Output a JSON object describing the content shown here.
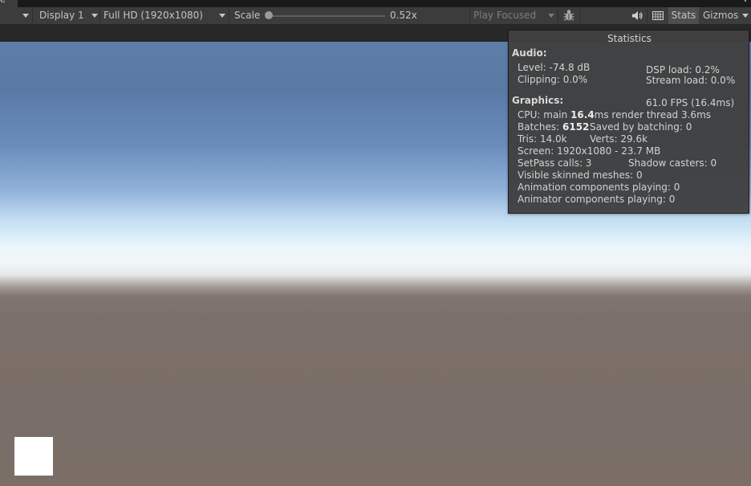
{
  "tab": {
    "label": "e"
  },
  "toolbar": {
    "display": "Display 1",
    "resolution": "Full HD (1920x1080)",
    "scale_label": "Scale",
    "scale_value": "0.52x",
    "scale_fraction": 0.0,
    "play_mode": "Play Focused",
    "stats_label": "Stats",
    "gizmos_label": "Gizmos",
    "icons": [
      "bug-icon",
      "speaker-icon",
      "keyboard-icon"
    ]
  },
  "stats": {
    "title": "Statistics",
    "audio_header": "Audio:",
    "level": "Level: -74.8 dB",
    "dsp_load": "DSP load: 0.2%",
    "clipping": "Clipping: 0.0%",
    "stream_load": "Stream load: 0.0%",
    "graphics_header": "Graphics:",
    "fps": "61.0 FPS (16.4ms)",
    "cpu_prefix": "CPU: main ",
    "cpu_main": "16.4",
    "cpu_suffix": "ms  render thread 3.6ms",
    "batches_prefix": "Batches: ",
    "batches_value": "6152",
    "saved_batching": "Saved by batching: 0",
    "tris": "Tris: 14.0k",
    "verts": "Verts: 29.6k",
    "screen": "Screen: 1920x1080 - 23.7 MB",
    "setpass": "SetPass calls: 3",
    "shadow_casters": "Shadow casters: 0",
    "skinned_meshes": "Visible skinned meshes: 0",
    "animation_components": "Animation components playing: 0",
    "animator_components": "Animator components playing: 0"
  },
  "colors": {
    "toolbar_bg": "#3c3c3c",
    "panel_bg": "#404040",
    "sky_top": "#5e7eaa",
    "horizon": "#f2f6f8",
    "ground": "#7a6e67"
  }
}
